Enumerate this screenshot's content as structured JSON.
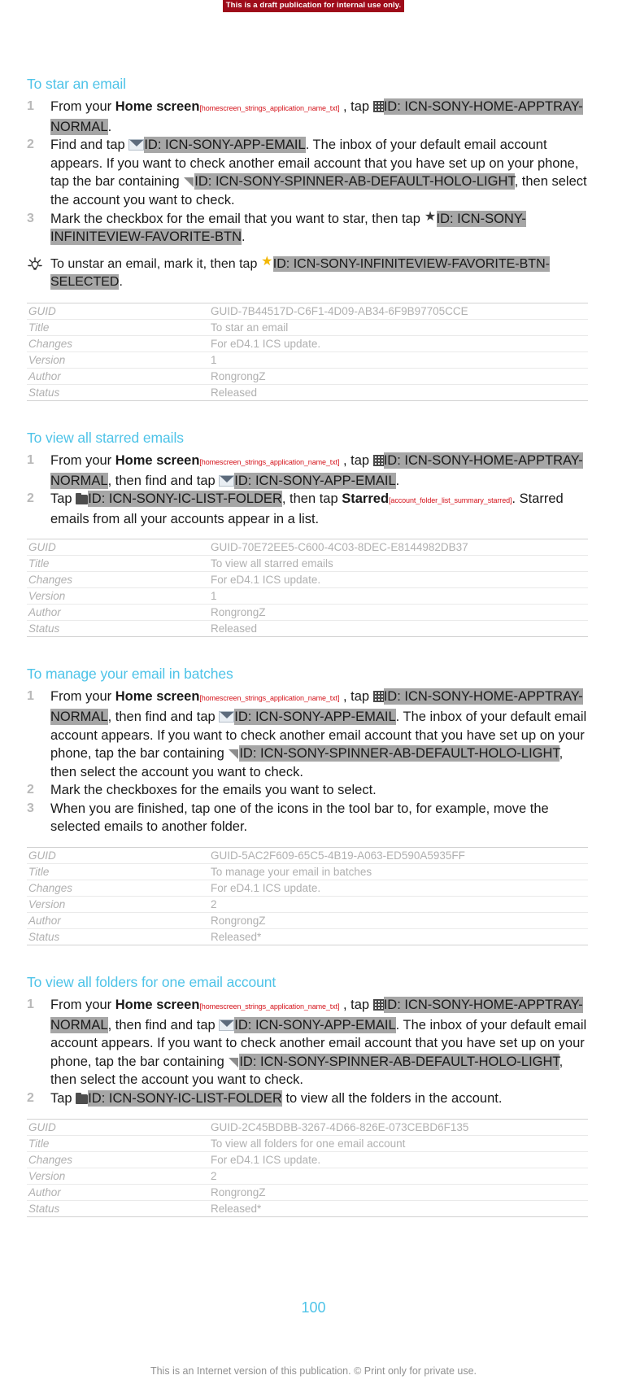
{
  "banner": {
    "text": "This is a draft publication for internal use only."
  },
  "footer": {
    "page_number": "100",
    "note": "This is an Internet version of this publication. © Print only for private use."
  },
  "colors": {
    "heading": "#4ec3e8",
    "banner_bg": "#9e0b1a",
    "string_id": "#d4121a",
    "highlight": "#a6a6a6",
    "table_text": "#b0b0b0",
    "step_number": "#b9b9b9"
  },
  "table_labels": {
    "guid": "GUID",
    "title": "Title",
    "changes": "Changes",
    "version": "Version",
    "author": "Author",
    "status": "Status"
  },
  "sections": [
    {
      "heading": "To star an email",
      "steps": [
        {
          "number": "1",
          "parts": [
            {
              "t": "From your ",
              "s": "plain"
            },
            {
              "t": "Home screen",
              "s": "bold"
            },
            {
              "t": "[homescreen_strings_application_name_txt]",
              "s": "strid"
            },
            {
              "t": " , tap ",
              "s": "plain"
            },
            {
              "t": "apptray-icon",
              "s": "icon"
            },
            {
              "t": "ID: ICN-SONY-HOME-APPTRAY-NORMAL",
              "s": "hl"
            },
            {
              "t": ".",
              "s": "plain"
            }
          ]
        },
        {
          "number": "2",
          "parts": [
            {
              "t": "Find and tap ",
              "s": "plain"
            },
            {
              "t": "email-icon",
              "s": "icon"
            },
            {
              "t": "ID: ICN-SONY-APP-EMAIL",
              "s": "hl"
            },
            {
              "t": ". The inbox of your default email account appears. If you want to check another email account that you have set up on your phone, tap the bar containing ",
              "s": "plain"
            },
            {
              "t": "spinner-icon",
              "s": "icon"
            },
            {
              "t": "ID: ICN-SONY-SPINNER-AB-DEFAULT-HOLO-LIGHT",
              "s": "hl"
            },
            {
              "t": ", then select the account you want to check.",
              "s": "plain"
            }
          ]
        },
        {
          "number": "3",
          "parts": [
            {
              "t": "Mark the checkbox for the email that you want to star, then tap ",
              "s": "plain"
            },
            {
              "t": "star-dark-icon",
              "s": "icon"
            },
            {
              "t": "ID: ICN-SONY-INFINITEVIEW-FAVORITE-BTN",
              "s": "hl"
            },
            {
              "t": ".",
              "s": "plain"
            }
          ]
        }
      ],
      "tip": {
        "parts": [
          {
            "t": "To unstar an email, mark it, then tap ",
            "s": "plain"
          },
          {
            "t": "star-gold-icon",
            "s": "icon"
          },
          {
            "t": "ID: ICN-SONY-INFINITEVIEW-FAVORITE-BTN-SELECTED",
            "s": "hl"
          },
          {
            "t": ".",
            "s": "plain"
          }
        ]
      },
      "meta": {
        "guid": "GUID-7B44517D-C6F1-4D09-AB34-6F9B97705CCE",
        "title": "To star an email",
        "changes": "For eD4.1 ICS update.",
        "version": "1",
        "author": "RongrongZ",
        "status": "Released"
      }
    },
    {
      "heading": "To view all starred emails",
      "steps": [
        {
          "number": "1",
          "parts": [
            {
              "t": "From your ",
              "s": "plain"
            },
            {
              "t": "Home screen",
              "s": "bold"
            },
            {
              "t": "[homescreen_strings_application_name_txt]",
              "s": "strid"
            },
            {
              "t": " , tap ",
              "s": "plain"
            },
            {
              "t": "apptray-icon",
              "s": "icon"
            },
            {
              "t": "ID: ICN-SONY-HOME-APPTRAY-NORMAL",
              "s": "hl"
            },
            {
              "t": ", then find and tap ",
              "s": "plain"
            },
            {
              "t": "email-icon",
              "s": "icon"
            },
            {
              "t": "ID: ICN-SONY-APP-EMAIL",
              "s": "hl"
            },
            {
              "t": ".",
              "s": "plain"
            }
          ]
        },
        {
          "number": "2",
          "parts": [
            {
              "t": "Tap ",
              "s": "plain"
            },
            {
              "t": "folder-icon",
              "s": "icon"
            },
            {
              "t": "ID: ICN-SONY-IC-LIST-FOLDER",
              "s": "hl"
            },
            {
              "t": ", then tap ",
              "s": "plain"
            },
            {
              "t": "Starred",
              "s": "bold"
            },
            {
              "t": "[account_folder_list_summary_starred]",
              "s": "strid"
            },
            {
              "t": ". Starred emails from all your accounts appear in a list.",
              "s": "plain"
            }
          ]
        }
      ],
      "meta": {
        "guid": "GUID-70E72EE5-C600-4C03-8DEC-E8144982DB37",
        "title": "To view all starred emails",
        "changes": "For eD4.1 ICS update.",
        "version": "1",
        "author": "RongrongZ",
        "status": "Released"
      }
    },
    {
      "heading": "To manage your email in batches",
      "steps": [
        {
          "number": "1",
          "parts": [
            {
              "t": "From your ",
              "s": "plain"
            },
            {
              "t": "Home screen",
              "s": "bold"
            },
            {
              "t": "[homescreen_strings_application_name_txt]",
              "s": "strid"
            },
            {
              "t": " , tap ",
              "s": "plain"
            },
            {
              "t": "apptray-icon",
              "s": "icon"
            },
            {
              "t": "ID: ICN-SONY-HOME-APPTRAY-NORMAL",
              "s": "hl"
            },
            {
              "t": ", then find and tap ",
              "s": "plain"
            },
            {
              "t": "email-icon",
              "s": "icon"
            },
            {
              "t": "ID: ICN-SONY-APP-EMAIL",
              "s": "hl"
            },
            {
              "t": ". The inbox of your default email account appears. If you want to check another email account that you have set up on your phone, tap the bar containing ",
              "s": "plain"
            },
            {
              "t": "spinner-icon",
              "s": "icon"
            },
            {
              "t": "ID: ICN-SONY-SPINNER-AB-DEFAULT-HOLO-LIGHT",
              "s": "hl"
            },
            {
              "t": ", then select the account you want to check.",
              "s": "plain"
            }
          ]
        },
        {
          "number": "2",
          "parts": [
            {
              "t": "Mark the checkboxes for the emails you want to select.",
              "s": "plain"
            }
          ]
        },
        {
          "number": "3",
          "parts": [
            {
              "t": "When you are finished, tap one of the icons in the tool bar to, for example, move the selected emails to another folder.",
              "s": "plain"
            }
          ]
        }
      ],
      "meta": {
        "guid": "GUID-5AC2F609-65C5-4B19-A063-ED590A5935FF",
        "title": "To manage your email in batches",
        "changes": "For eD4.1 ICS update.",
        "version": "2",
        "author": "RongrongZ",
        "status": "Released*"
      }
    },
    {
      "heading": "To view all folders for one email account",
      "steps": [
        {
          "number": "1",
          "parts": [
            {
              "t": "From your ",
              "s": "plain"
            },
            {
              "t": "Home screen",
              "s": "bold"
            },
            {
              "t": "[homescreen_strings_application_name_txt]",
              "s": "strid"
            },
            {
              "t": " , tap ",
              "s": "plain"
            },
            {
              "t": "apptray-icon",
              "s": "icon"
            },
            {
              "t": "ID: ICN-SONY-HOME-APPTRAY-NORMAL",
              "s": "hl"
            },
            {
              "t": ", then find and tap ",
              "s": "plain"
            },
            {
              "t": "email-icon",
              "s": "icon"
            },
            {
              "t": "ID: ICN-SONY-APP-EMAIL",
              "s": "hl"
            },
            {
              "t": ". The inbox of your default email account appears. If you want to check another email account that you have set up on your phone, tap the bar containing ",
              "s": "plain"
            },
            {
              "t": "spinner-icon",
              "s": "icon"
            },
            {
              "t": "ID: ICN-SONY-SPINNER-AB-DEFAULT-HOLO-LIGHT",
              "s": "hl"
            },
            {
              "t": ", then select the account you want to check.",
              "s": "plain"
            }
          ]
        },
        {
          "number": "2",
          "parts": [
            {
              "t": "Tap ",
              "s": "plain"
            },
            {
              "t": "folder-icon",
              "s": "icon"
            },
            {
              "t": "ID: ICN-SONY-IC-LIST-FOLDER",
              "s": "hl"
            },
            {
              "t": " to view all the folders in the account.",
              "s": "plain"
            }
          ]
        }
      ],
      "meta": {
        "guid": "GUID-2C45BDBB-3267-4D66-826E-073CEBD6F135",
        "title": "To view all folders for one email account",
        "changes": "For eD4.1 ICS update.",
        "version": "2",
        "author": "RongrongZ",
        "status": "Released*"
      }
    }
  ]
}
